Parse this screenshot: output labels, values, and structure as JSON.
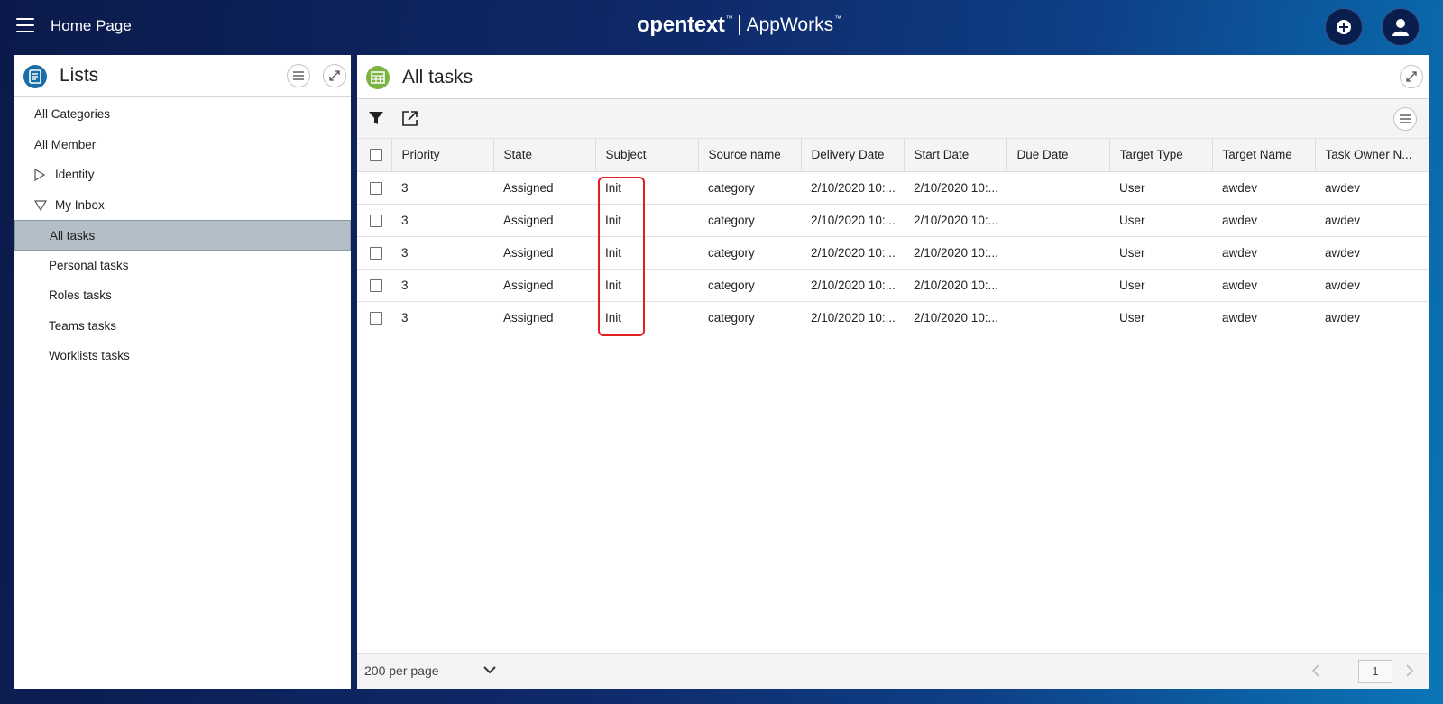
{
  "topbar": {
    "home_title": "Home Page",
    "brand_main": "opentext",
    "brand_tm": "™",
    "brand_product": "AppWorks",
    "product_tm": "™"
  },
  "lists_panel": {
    "title": "Lists",
    "items": [
      {
        "label": "All Categories"
      },
      {
        "label": "All Member"
      },
      {
        "label": "Identity"
      },
      {
        "label": "My Inbox"
      },
      {
        "label": "All tasks"
      },
      {
        "label": "Personal tasks"
      },
      {
        "label": "Roles tasks"
      },
      {
        "label": "Teams tasks"
      },
      {
        "label": "Worklists tasks"
      }
    ]
  },
  "tasks_panel": {
    "title": "All tasks",
    "columns": [
      "Priority",
      "State",
      "Subject",
      "Source name",
      "Delivery Date",
      "Start Date",
      "Due Date",
      "Target Type",
      "Target Name",
      "Task Owner N..."
    ],
    "rows": [
      [
        "3",
        "Assigned",
        "Init",
        "category",
        "2/10/2020 10:...",
        "2/10/2020 10:...",
        "",
        "User",
        "awdev",
        "awdev"
      ],
      [
        "3",
        "Assigned",
        "Init",
        "category",
        "2/10/2020 10:...",
        "2/10/2020 10:...",
        "",
        "User",
        "awdev",
        "awdev"
      ],
      [
        "3",
        "Assigned",
        "Init",
        "category",
        "2/10/2020 10:...",
        "2/10/2020 10:...",
        "",
        "User",
        "awdev",
        "awdev"
      ],
      [
        "3",
        "Assigned",
        "Init",
        "category",
        "2/10/2020 10:...",
        "2/10/2020 10:...",
        "",
        "User",
        "awdev",
        "awdev"
      ],
      [
        "3",
        "Assigned",
        "Init",
        "category",
        "2/10/2020 10:...",
        "2/10/2020 10:...",
        "",
        "User",
        "awdev",
        "awdev"
      ]
    ],
    "footer": {
      "per_page": "200 per page",
      "page": "1"
    }
  },
  "colors": {
    "accent_red": "#e02020",
    "lists_icon": "#1b6fa8",
    "tasks_icon": "#7cb342",
    "selected_row": "#b3bec6"
  }
}
